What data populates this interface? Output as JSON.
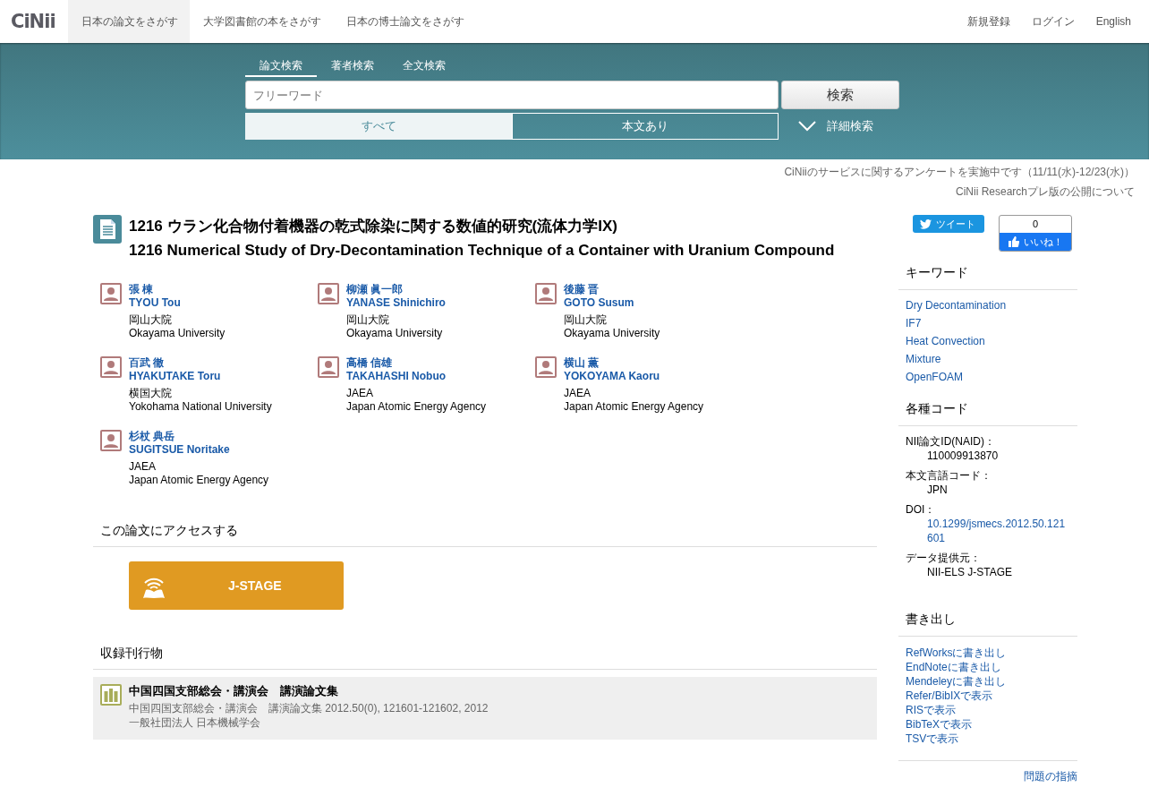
{
  "header": {
    "logo": "CiNii",
    "nav": [
      {
        "label": "日本の論文をさがす",
        "selected": true
      },
      {
        "label": "大学図書館の本をさがす",
        "selected": false
      },
      {
        "label": "日本の博士論文をさがす",
        "selected": false
      }
    ],
    "account_links": [
      "新規登録",
      "ログイン",
      "English"
    ]
  },
  "search": {
    "tabs": [
      {
        "label": "論文検索",
        "selected": true
      },
      {
        "label": "著者検索",
        "selected": false
      },
      {
        "label": "全文検索",
        "selected": false
      }
    ],
    "placeholder": "フリーワード",
    "button": "検索",
    "filters": [
      {
        "label": "すべて",
        "selected": true
      },
      {
        "label": "本文あり",
        "selected": false
      }
    ],
    "advanced": "詳細検索"
  },
  "notices": [
    "CiNiiのサービスに関するアンケートを実施中です（11/11(水)-12/23(水)）",
    "CiNii Researchプレ版の公開について"
  ],
  "article": {
    "title_ja": "1216 ウラン化合物付着機器の乾式除染に関する数値的研究(流体力学IX)",
    "title_en": "1216 Numerical Study of Dry-Decontamination Technique of a Container with Uranium Compound",
    "authors": [
      {
        "name_ja": "張 棟",
        "name_en": "TYOU Tou",
        "affiliation_ja": "岡山大院",
        "affiliation_en": "Okayama University"
      },
      {
        "name_ja": "柳瀬 眞一郎",
        "name_en": "YANASE Shinichiro",
        "affiliation_ja": "岡山大院",
        "affiliation_en": "Okayama University"
      },
      {
        "name_ja": "後藤 晋",
        "name_en": "GOTO Susum",
        "affiliation_ja": "岡山大院",
        "affiliation_en": "Okayama University"
      },
      {
        "name_ja": "百武 徹",
        "name_en": "HYAKUTAKE Toru",
        "affiliation_ja": "横国大院",
        "affiliation_en": "Yokohama National University"
      },
      {
        "name_ja": "高橋 信雄",
        "name_en": "TAKAHASHI Nobuo",
        "affiliation_ja": "JAEA",
        "affiliation_en": "Japan Atomic Energy Agency"
      },
      {
        "name_ja": "横山 薫",
        "name_en": "YOKOYAMA Kaoru",
        "affiliation_ja": "JAEA",
        "affiliation_en": "Japan Atomic Energy Agency"
      },
      {
        "name_ja": "杉杖 典岳",
        "name_en": "SUGITSUE Noritake",
        "affiliation_ja": "JAEA",
        "affiliation_en": "Japan Atomic Energy Agency"
      }
    ],
    "access": {
      "heading": "この論文にアクセスする",
      "button": "J-STAGE"
    },
    "journal": {
      "heading": "収録刊行物",
      "title": "中国四国支部総会・講演会　講演論文集",
      "citation": "中国四国支部総会・講演会　講演論文集 2012.50(0), 121601-121602, 2012",
      "publisher": "一般社団法人 日本機械学会"
    }
  },
  "sidebar": {
    "tweet": "ツイート",
    "like_count": "0",
    "like": "いいね！",
    "keywords": {
      "heading": "キーワード",
      "items": [
        "Dry Decontamination",
        "IF7",
        "Heat Convection",
        "Mixture",
        "OpenFOAM"
      ]
    },
    "codes": {
      "heading": "各種コード",
      "items": [
        {
          "label": "NII論文ID(NAID)：",
          "value": "110009913870",
          "kind": "text"
        },
        {
          "label": "本文言語コード：",
          "value": "JPN",
          "kind": "text"
        },
        {
          "label": "DOI：",
          "value": "10.1299/jsmecs.2012.50.121601",
          "kind": "link"
        },
        {
          "label": "データ提供元：",
          "value": "NII-ELS  J-STAGE",
          "kind": "text"
        }
      ]
    },
    "export": {
      "heading": "書き出し",
      "items": [
        "RefWorksに書き出し",
        "EndNoteに書き出し",
        "Mendeleyに書き出し",
        "Refer/BibIXで表示",
        "RISで表示",
        "BibTeXで表示",
        "TSVで表示"
      ]
    },
    "report": "問題の指摘"
  }
}
